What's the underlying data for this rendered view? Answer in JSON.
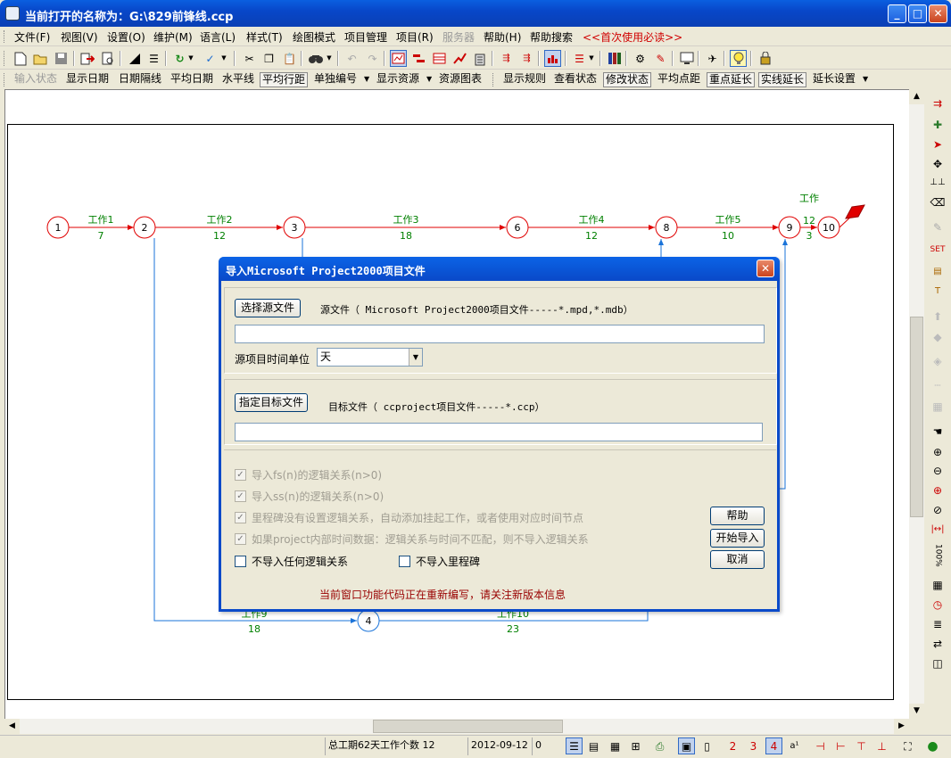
{
  "window": {
    "title": "当前打开的名称为：G:\\829前锋线.ccp"
  },
  "menu": [
    "文件(F)",
    "视图(V)",
    "设置(O)",
    "维护(M)",
    "语言(L)",
    "样式(T)",
    "绘图模式",
    "项目管理",
    "项目(R)",
    "服务器",
    "帮助(H)",
    "帮助搜索",
    "<<首次使用必读>>"
  ],
  "toolbar2": [
    "输入状态",
    "显示日期",
    "日期隔线",
    "平均日期",
    "水平线",
    "平均行距",
    "单独编号",
    "显示资源",
    "资源图表",
    "显示规则",
    "查看状态",
    "修改状态",
    "平均点距",
    "重点延长",
    "实线延长",
    "延长设置"
  ],
  "network": {
    "nodes": [
      "1",
      "2",
      "3",
      "6",
      "8",
      "9",
      "10",
      "4"
    ],
    "tasks": [
      {
        "name": "工作1",
        "duration": "7"
      },
      {
        "name": "工作2",
        "duration": "12"
      },
      {
        "name": "工作3",
        "duration": "18"
      },
      {
        "name": "工作4",
        "duration": "12"
      },
      {
        "name": "工作5",
        "duration": "10"
      },
      {
        "name": "工作",
        "duration": "12"
      },
      {
        "name": "工作9",
        "duration": "18"
      },
      {
        "name": "工作10",
        "duration": "23"
      },
      {
        "name": "",
        "duration": "3"
      }
    ],
    "critical_color": "#e00000",
    "normal_color": "#1a73d9",
    "label_color": "#008000"
  },
  "dialog": {
    "title": "导入Microsoft Project2000项目文件",
    "select_source_button": "选择源文件",
    "source_label": "源文件（ Microsoft Project2000项目文件-----*.mpd,*.mdb）",
    "source_path": "",
    "time_unit_label": "源项目时间单位",
    "time_unit_value": "天",
    "select_target_button": "指定目标文件",
    "target_label": "目标文件（ ccproject项目文件-----*.ccp）",
    "target_path": "",
    "options": [
      {
        "label": "导入fs(n)的逻辑关系(n>0)",
        "checked": true,
        "enabled": false
      },
      {
        "label": "导入ss(n)的逻辑关系(n>0)",
        "checked": true,
        "enabled": false
      },
      {
        "label": "里程碑没有设置逻辑关系，自动添加挂起工作，或者使用对应时间节点",
        "checked": true,
        "enabled": false
      },
      {
        "label": "如果project内部时间数据：逻辑关系与时间不匹配，则不导入逻辑关系",
        "checked": true,
        "enabled": false
      }
    ],
    "no_logic_label": "不导入任何逻辑关系",
    "no_milestone_label": "不导入里程碑",
    "help_button": "帮助",
    "start_import_button": "开始导入",
    "cancel_button": "取消",
    "note": "当前窗口功能代码正在重新编写，请关注新版本信息"
  },
  "status": {
    "summary": "总工期62天工作个数 12",
    "date": "2012-09-12",
    "value": "0",
    "zoom": "100%"
  },
  "icons": {
    "toolbar1": [
      "new-file-icon",
      "open-folder-icon",
      "save-icon",
      "export-icon",
      "print-preview-icon",
      "triangle-icon",
      "indent-icon",
      "refresh-icon",
      "check-icon",
      "cut-icon",
      "copy-icon",
      "paste-icon",
      "find-icon",
      "undo-icon",
      "redo-icon",
      "network-view-icon",
      "gantt-view-icon",
      "table-view-icon",
      "line-chart-icon",
      "building-icon",
      "node-a-icon",
      "node-b-icon",
      "resource-chart-icon",
      "align-icon",
      "books-icon",
      "people-icon",
      "edit-doc-icon",
      "monitor-icon",
      "plane-icon",
      "lightbulb-icon",
      "lock-icon"
    ]
  }
}
